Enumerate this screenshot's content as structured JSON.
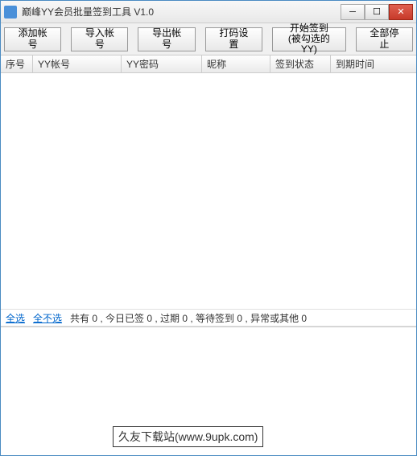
{
  "window": {
    "title": "巅峰YY会员批量签到工具  V1.0"
  },
  "toolbar": {
    "add_account": "添加帐号",
    "import_account": "导入帐号",
    "export_account": "导出帐号",
    "captcha_settings": "打码设置",
    "start_sign": "开始签到\n(被勾选的YY)",
    "stop_all": "全部停止"
  },
  "columns": {
    "seq": "序号",
    "yy_account": "YY帐号",
    "yy_password": "YY密码",
    "nickname": "昵称",
    "sign_status": "签到状态",
    "expire_time": "到期时间"
  },
  "status": {
    "select_all": "全选",
    "select_none": "全不选",
    "stats": "共有 0 , 今日已签 0 , 过期 0 , 等待签到 0 , 异常或其他 0"
  },
  "watermark": "久友下载站(www.9upk.com)"
}
